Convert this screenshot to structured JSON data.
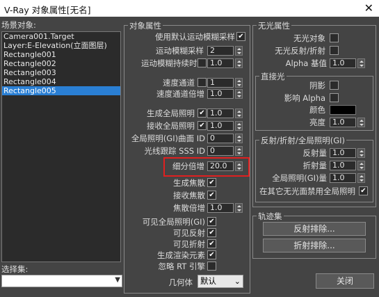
{
  "window": {
    "title": "V-Ray 对象属性[无名]",
    "close": "✕"
  },
  "scene": {
    "label": "场景对象:",
    "items": [
      "Camera001.Target",
      "Layer:E-Elevation(立面图层)",
      "Rectangle001",
      "Rectangle002",
      "Rectangle003",
      "Rectangle004",
      "Rectangle005"
    ],
    "selected_index": 6,
    "selection_set_label": "选择集:",
    "selection_set_value": ""
  },
  "obj": {
    "title": "对象属性",
    "use_default_mb": "使用默认运动模糊采样",
    "mb_samples": "运动模糊采样",
    "mb_samples_val": "2",
    "mb_duration": "运动模糊持续时间",
    "mb_duration_val": "1.0",
    "vel_channel": "速度通道",
    "vel_channel_val": "1",
    "vel_mult": "速度通道倍增",
    "vel_mult_val": "1.0",
    "gen_gi": "生成全局照明",
    "gen_gi_val": "1.0",
    "recv_gi": "接收全局照明",
    "recv_gi_val": "1.0",
    "gi_surf_id": "全局照明(GI)曲面 ID",
    "gi_surf_id_val": "0",
    "sss_id": "光线跟踪 SSS ID",
    "sss_id_val": "0",
    "subdiv_mult": "细分倍增",
    "subdiv_mult_val": "20.0",
    "gen_caustics": "生成焦散",
    "recv_caustics": "接收焦散",
    "caustics_mult": "焦散倍增",
    "caustics_mult_val": "1.0",
    "vis_gi": "可见全局照明(GI)",
    "vis_refl": "可见反射",
    "vis_refr": "可见折射",
    "gen_render_elem": "生成渲染元素",
    "ignore_rt": "忽略 RT 引擎",
    "geometry": "几何体",
    "geometry_val": "默认"
  },
  "matte": {
    "title": "无光属性",
    "matte_obj": "无光对象",
    "matte_refl": "无光反射/折射",
    "alpha_base": "Alpha 基值",
    "alpha_base_val": "1.0",
    "direct_title": "直接光",
    "shadows": "阴影",
    "affect_alpha": "影响 Alpha",
    "color": "颜色",
    "brightness": "亮度",
    "brightness_val": "1.0",
    "refl_title": "反射/折射/全局照明(GI)",
    "refl_amount": "反射量",
    "refl_amount_val": "1.0",
    "refr_amount": "折射量",
    "refr_amount_val": "1.0",
    "gi_amount": "全局照明(GI)量",
    "gi_amount_val": "1.0",
    "no_gi_on_other": "在其它无光面禁用全局照明"
  },
  "trace": {
    "title": "轨迹集",
    "refl_exclude": "反射排除...",
    "refr_exclude": "折射排除..."
  },
  "close_button": "关闭",
  "colors": {
    "highlight": "#e02020",
    "selection": "#2a7fd4",
    "swatch": "#000000"
  }
}
